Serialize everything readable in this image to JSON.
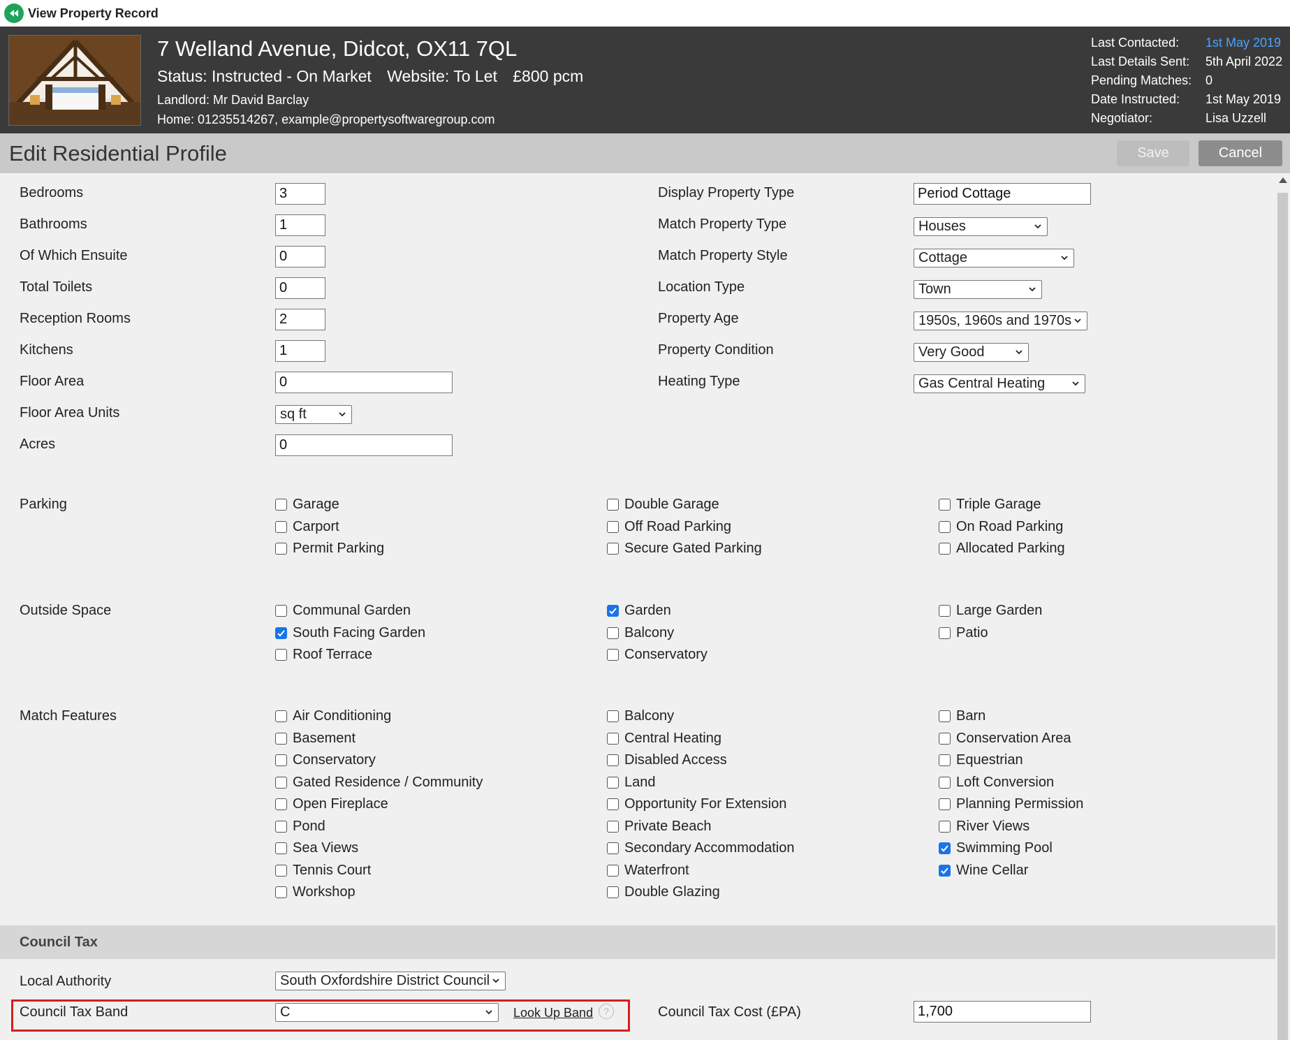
{
  "topbar": {
    "title": "View Property Record"
  },
  "header": {
    "address": "7 Welland Avenue, Didcot, OX11 7QL",
    "status": "Status: Instructed - On Market",
    "website": "Website: To Let",
    "price": "£800 pcm",
    "landlord": "Landlord: Mr David Barclay",
    "home": "Home: 01235514267, example@propertysoftwaregroup.com",
    "meta": [
      {
        "key": "Last Contacted:",
        "value": "1st May 2019"
      },
      {
        "key": "Last Details Sent:",
        "value": "5th April 2022"
      },
      {
        "key": "Pending Matches:",
        "value": "0"
      },
      {
        "key": "Date Instructed:",
        "value": "1st May 2019"
      },
      {
        "key": "Negotiator:",
        "value": "Lisa Uzzell"
      }
    ]
  },
  "editbar": {
    "title": "Edit Residential Profile",
    "save": "Save",
    "cancel": "Cancel"
  },
  "left_fields": [
    {
      "label": "Bedrooms",
      "value": "3"
    },
    {
      "label": "Bathrooms",
      "value": "1"
    },
    {
      "label": "Of Which Ensuite",
      "value": "0"
    },
    {
      "label": "Total Toilets",
      "value": "0"
    },
    {
      "label": "Reception Rooms",
      "value": "2"
    },
    {
      "label": "Kitchens",
      "value": "1"
    },
    {
      "label": "Floor Area",
      "value": "0"
    },
    {
      "label": "Floor Area Units",
      "value": "sq ft"
    },
    {
      "label": "Acres",
      "value": "0"
    }
  ],
  "right_fields": [
    {
      "label": "Display Property Type",
      "value": "Period Cottage"
    },
    {
      "label": "Match Property Type",
      "value": "Houses"
    },
    {
      "label": "Match Property Style",
      "value": "Cottage"
    },
    {
      "label": "Location Type",
      "value": "Town"
    },
    {
      "label": "Property Age",
      "value": "1950s, 1960s and 1970s"
    },
    {
      "label": "Property Condition",
      "value": "Very Good"
    },
    {
      "label": "Heating Type",
      "value": "Gas Central Heating"
    }
  ],
  "parking": {
    "label": "Parking",
    "items": [
      {
        "label": "Garage",
        "checked": false
      },
      {
        "label": "Double Garage",
        "checked": false
      },
      {
        "label": "Triple Garage",
        "checked": false
      },
      {
        "label": "Carport",
        "checked": false
      },
      {
        "label": "Off Road Parking",
        "checked": false
      },
      {
        "label": "On Road Parking",
        "checked": false
      },
      {
        "label": "Permit Parking",
        "checked": false
      },
      {
        "label": "Secure Gated Parking",
        "checked": false
      },
      {
        "label": "Allocated Parking",
        "checked": false
      }
    ]
  },
  "outside": {
    "label": "Outside Space",
    "items": [
      {
        "label": "Communal Garden",
        "checked": false
      },
      {
        "label": "Garden",
        "checked": true
      },
      {
        "label": "Large Garden",
        "checked": false
      },
      {
        "label": "South Facing Garden",
        "checked": true
      },
      {
        "label": "Balcony",
        "checked": false
      },
      {
        "label": "Patio",
        "checked": false
      },
      {
        "label": "Roof Terrace",
        "checked": false
      },
      {
        "label": "Conservatory",
        "checked": false
      }
    ]
  },
  "features": {
    "label": "Match Features",
    "items": [
      {
        "label": "Air Conditioning",
        "checked": false
      },
      {
        "label": "Balcony",
        "checked": false
      },
      {
        "label": "Barn",
        "checked": false
      },
      {
        "label": "Basement",
        "checked": false
      },
      {
        "label": "Central Heating",
        "checked": false
      },
      {
        "label": "Conservation Area",
        "checked": false
      },
      {
        "label": "Conservatory",
        "checked": false
      },
      {
        "label": "Disabled Access",
        "checked": false
      },
      {
        "label": "Equestrian",
        "checked": false
      },
      {
        "label": "Gated Residence / Community",
        "checked": false
      },
      {
        "label": "Land",
        "checked": false
      },
      {
        "label": "Loft Conversion",
        "checked": false
      },
      {
        "label": "Open Fireplace",
        "checked": false
      },
      {
        "label": "Opportunity For Extension",
        "checked": false
      },
      {
        "label": "Planning Permission",
        "checked": false
      },
      {
        "label": "Pond",
        "checked": false
      },
      {
        "label": "Private Beach",
        "checked": false
      },
      {
        "label": "River Views",
        "checked": false
      },
      {
        "label": "Sea Views",
        "checked": false
      },
      {
        "label": "Secondary Accommodation",
        "checked": false
      },
      {
        "label": "Swimming Pool",
        "checked": true
      },
      {
        "label": "Tennis Court",
        "checked": false
      },
      {
        "label": "Waterfront",
        "checked": false
      },
      {
        "label": "Wine Cellar",
        "checked": true
      },
      {
        "label": "Workshop",
        "checked": false
      },
      {
        "label": "Double Glazing",
        "checked": false
      }
    ]
  },
  "council": {
    "section": "Council Tax",
    "authority_label": "Local Authority",
    "authority_value": "South Oxfordshire District Council",
    "band_label": "Council Tax Band",
    "band_value": "C",
    "lookup": "Look Up Band",
    "help": "?",
    "cost_label": "Council Tax Cost (£PA)",
    "cost_value": "1,700"
  },
  "colors": {
    "header_bg": "#3a3a3a",
    "accent_link": "#4aa3ff",
    "checkbox_on": "#1a73e8",
    "highlight": "#d21f1f",
    "back_icon": "#1fa35a"
  }
}
